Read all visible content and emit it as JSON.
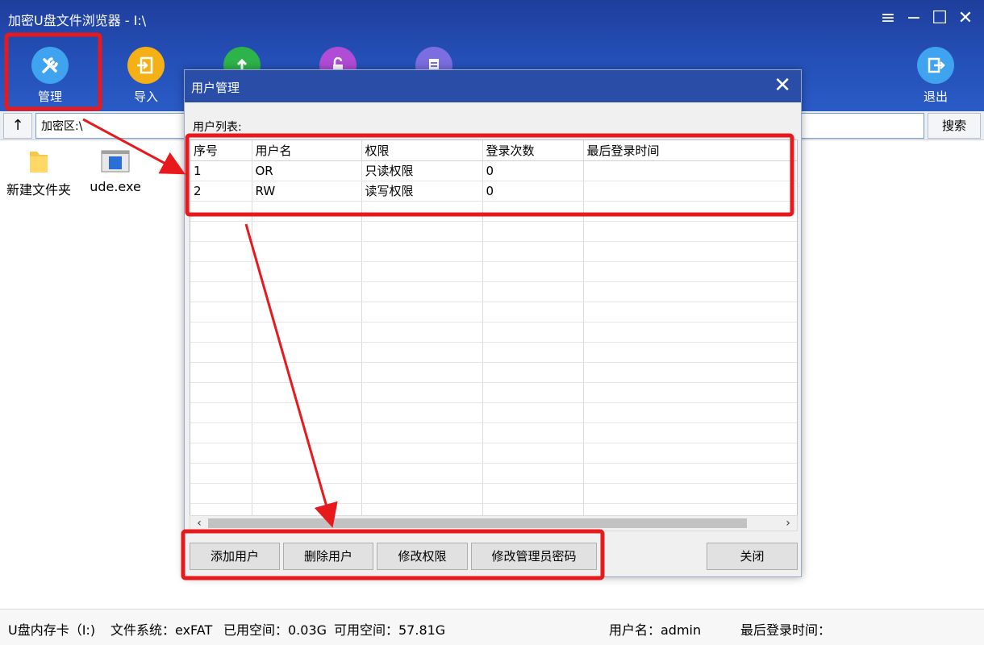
{
  "window": {
    "title": "加密U盘文件浏览器 - I:\\"
  },
  "toolbar": {
    "manage_label": "管理",
    "import_label": "导入",
    "exit_label": "退出"
  },
  "address": {
    "up_label": "↑",
    "path": "加密区:\\",
    "search_label": "搜索"
  },
  "files": [
    {
      "name": "新建文件夹",
      "icon": "folder-icon"
    },
    {
      "name": "ude.exe",
      "icon": "exe-icon"
    }
  ],
  "dialog": {
    "title": "用户管理",
    "list_label": "用户列表:",
    "columns": [
      "序号",
      "用户名",
      "权限",
      "登录次数",
      "最后登录时间"
    ],
    "rows": [
      [
        "1",
        "OR",
        "只读权限",
        "0",
        ""
      ],
      [
        "2",
        "RW",
        "读写权限",
        "0",
        ""
      ]
    ],
    "buttons": {
      "add": "添加用户",
      "delete": "删除用户",
      "modify_perm": "修改权限",
      "modify_admin_pwd": "修改管理员密码",
      "close": "关闭"
    }
  },
  "status": {
    "drive": "U盘内存卡（I:)",
    "fs": "文件系统：exFAT",
    "used": "已用空间：0.03G",
    "free": "可用空间：57.81G",
    "user": "用户名：admin",
    "last_login": "最后登录时间："
  },
  "colors": {
    "band": "#2450b8",
    "annotation": "#e8191c"
  }
}
